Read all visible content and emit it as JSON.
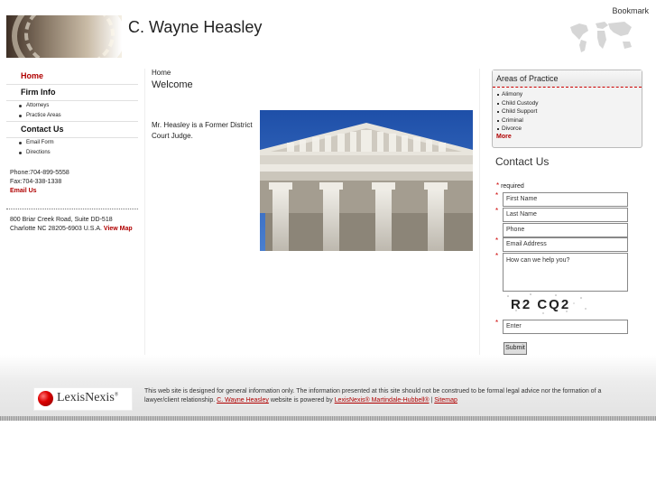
{
  "header": {
    "bookmark": "Bookmark",
    "title": "C. Wayne Heasley"
  },
  "nav": {
    "home": "Home",
    "firm_info": "Firm Info",
    "attorneys": "Attorneys",
    "practice_areas": "Practice Areas",
    "contact_us": "Contact Us",
    "email_form": "Email Form",
    "directions": "Directions"
  },
  "contact": {
    "phone": "Phone:704-899-5558",
    "fax": "Fax:704-338-1338",
    "email_link": "Email Us",
    "address_line1": "800 Briar Creek Road, Suite DD-518",
    "address_line2": "Charlotte NC 28205-6903 U.S.A.",
    "map_link": "View Map"
  },
  "main": {
    "breadcrumb": "Home",
    "heading": "Welcome",
    "bio": "Mr. Heasley is a Former District Court Judge."
  },
  "areas_of_practice": {
    "title": "Areas of Practice",
    "items": [
      "Alimony",
      "Child Custody",
      "Child Support",
      "Criminal",
      "Divorce"
    ],
    "more": "More"
  },
  "contact_form": {
    "heading": "Contact Us",
    "required_note": "required",
    "required_star": "*",
    "first_name": "First Name",
    "last_name": "Last Name",
    "phone": "Phone",
    "email": "Email Address",
    "message": "How can we help you?",
    "captcha_text": "R2 CQ2",
    "captcha_input": "Enter",
    "submit": "Submit"
  },
  "footer": {
    "logo_text": "LexisNexis",
    "logo_mark": "®",
    "disclaimer": "This web site is designed for general information only. The information presented at this site should not be construed to be formal legal advice nor the formation of a lawyer/client relationship.",
    "site_link": "C. Wayne Heasley",
    "powered_text": "website is powered by",
    "lexis_link": "LexisNexis® Martindale-Hubbell®",
    "separator": "|",
    "sitemap_link": "Sitemap"
  },
  "colors": {
    "accent": "#b00000"
  }
}
